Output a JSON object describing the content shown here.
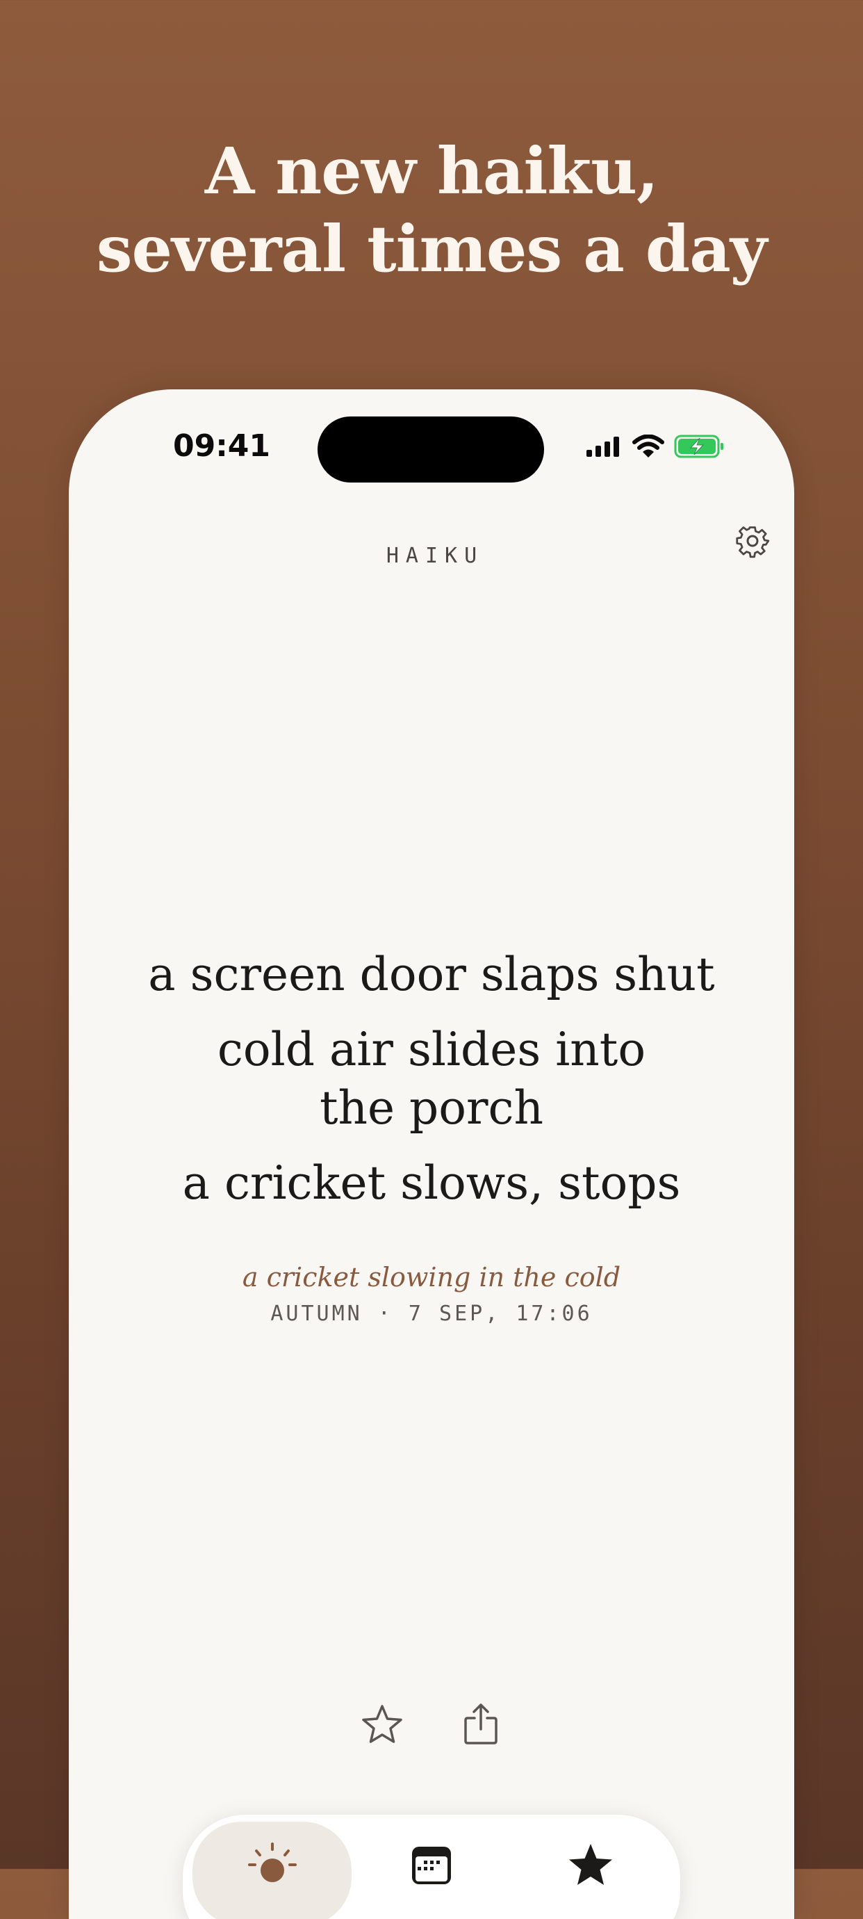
{
  "headline": {
    "line1": "A new haiku,",
    "line2": "several times a day"
  },
  "status_bar": {
    "time": "09:41",
    "icons": [
      "cellular-signal-icon",
      "wifi-icon",
      "battery-charging-icon"
    ]
  },
  "app": {
    "title": "HAIKU",
    "settings_icon": "gear-icon"
  },
  "haiku": {
    "line1": "a screen door slaps shut",
    "line2": "cold air slides into the porch",
    "line3": "a cricket slows, stops",
    "caption": "a cricket slowing in the cold",
    "meta": "AUTUMN · 7 SEP, 17:06"
  },
  "actions": {
    "favorite_icon": "star-outline-icon",
    "share_icon": "share-icon"
  },
  "tabbar": {
    "tabs": [
      {
        "icon": "sun-icon",
        "active": true
      },
      {
        "icon": "calendar-icon",
        "active": false
      },
      {
        "icon": "star-filled-icon",
        "active": false
      }
    ]
  },
  "colors": {
    "background_top": "#8e5b3d",
    "background_bottom": "#5a3627",
    "accent": "#8a5a3f",
    "battery_green": "#34c759"
  }
}
